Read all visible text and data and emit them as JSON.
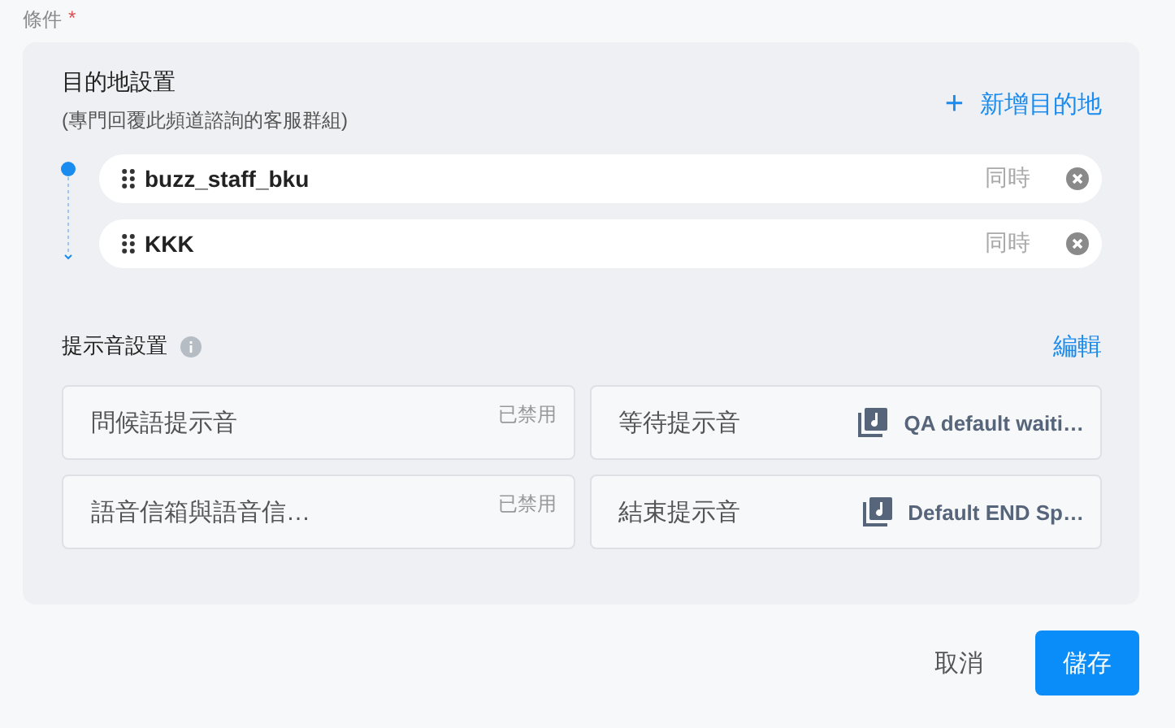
{
  "field_label": "條件",
  "required_mark": "*",
  "destinations": {
    "title": "目的地設置",
    "subtitle": "(專門回覆此頻道諮詢的客服群組)",
    "add_button": "+",
    "add_label": "新增目的地",
    "items": [
      {
        "name": "buzz_staff_bku",
        "mode": "同時"
      },
      {
        "name": "KKK",
        "mode": "同時"
      }
    ]
  },
  "sounds": {
    "title": "提示音設置",
    "edit_link": "編輯",
    "items": [
      {
        "label": "問候語提示音",
        "kind": "disabled",
        "status": "已禁用"
      },
      {
        "label": "等待提示音",
        "kind": "file",
        "file": "QA default waiti…"
      },
      {
        "label": "語音信箱與語音信…",
        "kind": "disabled",
        "status": "已禁用"
      },
      {
        "label": "結束提示音",
        "kind": "file",
        "file": "Default END Sp…"
      }
    ]
  },
  "buttons": {
    "cancel": "取消",
    "save": "儲存"
  }
}
